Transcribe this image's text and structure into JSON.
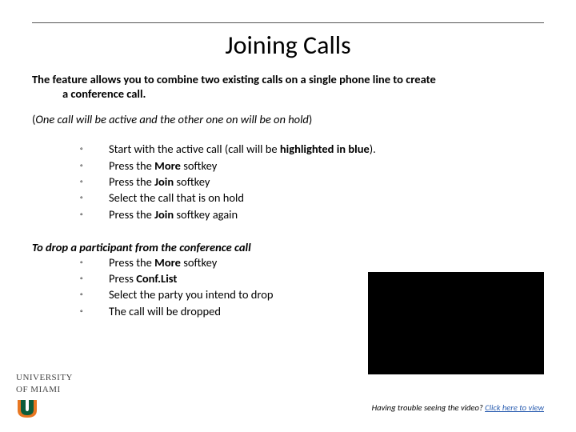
{
  "title": "Joining Calls",
  "intro_line1": "The feature allows you to combine two existing calls on a single phone line to create",
  "intro_line2": "a conference call.",
  "note_open": "(",
  "note_italic": "One call will be active and the other one on will be on hold",
  "note_close": ")",
  "steps": {
    "s1a": "Start with the active call (call will be ",
    "s1b": "highlighted in blue",
    "s1c": ").",
    "s2a": "Press the ",
    "s2b": "More ",
    "s2c": "softkey",
    "s3a": "Press the ",
    "s3b": "Join ",
    "s3c": "softkey",
    "s4": "Select the call that is on hold",
    "s5a": "Press the ",
    "s5b": "Join ",
    "s5c": "softkey again"
  },
  "drop_heading": "To drop a participant from the conference call",
  "drop": {
    "d1a": "Press the ",
    "d1b": "More ",
    "d1c": "softkey",
    "d2a": "Press ",
    "d2b": "Conf.List",
    "d3": "Select the party you intend to drop",
    "d4": "The call will be dropped"
  },
  "trouble_text": "Having trouble seeing the video? ",
  "trouble_link": "Click here to view",
  "logo": {
    "line1": "UNIVERSITY",
    "line2": "OF MIAMI"
  }
}
